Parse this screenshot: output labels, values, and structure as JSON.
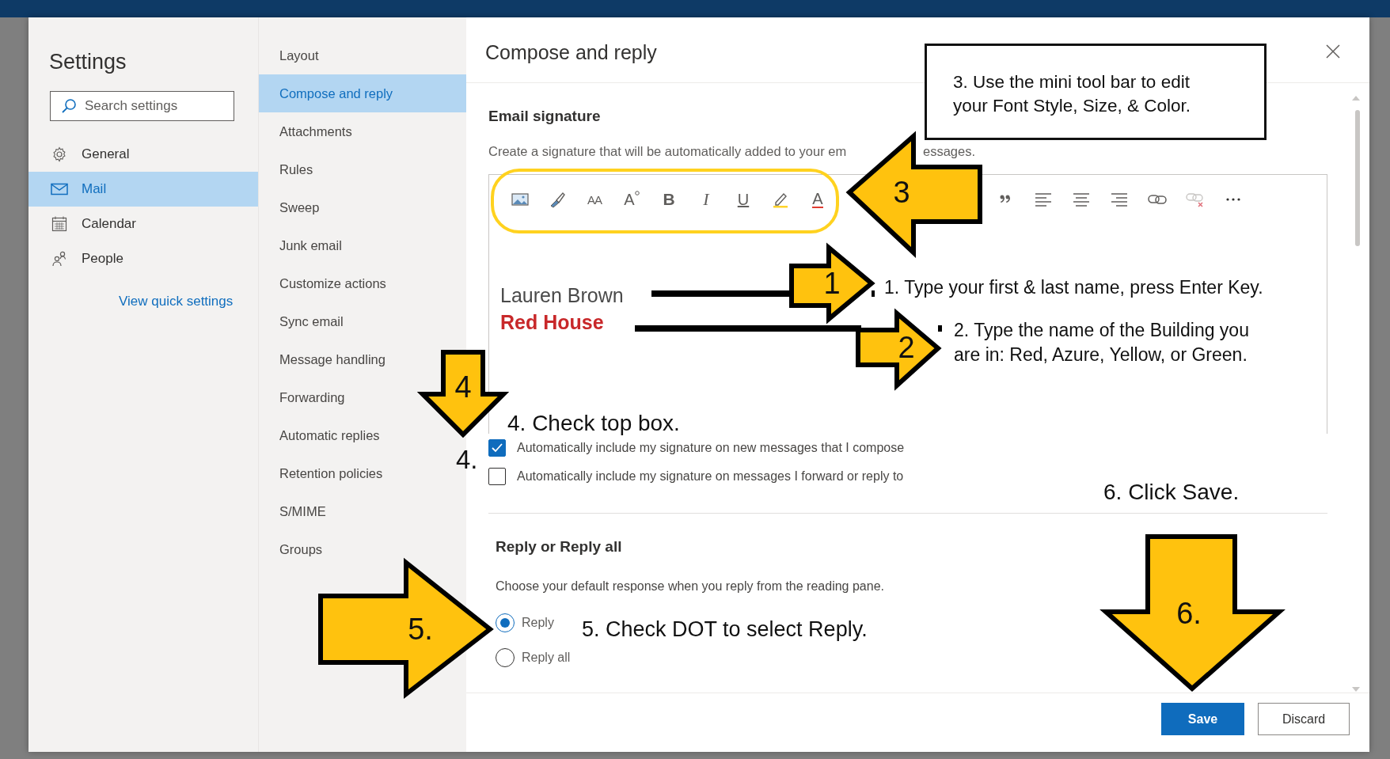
{
  "nav": {
    "title": "Settings",
    "search": {
      "placeholder": "Search settings"
    },
    "items": [
      {
        "label": "General",
        "selected": false
      },
      {
        "label": "Mail",
        "selected": true
      },
      {
        "label": "Calendar",
        "selected": false
      },
      {
        "label": "People",
        "selected": false
      }
    ],
    "link": "View quick settings"
  },
  "subnav": {
    "items": [
      {
        "label": "Layout",
        "selected": false
      },
      {
        "label": "Compose and reply",
        "selected": true
      },
      {
        "label": "Attachments",
        "selected": false
      },
      {
        "label": "Rules",
        "selected": false
      },
      {
        "label": "Sweep",
        "selected": false
      },
      {
        "label": "Junk email",
        "selected": false
      },
      {
        "label": "Customize actions",
        "selected": false
      },
      {
        "label": "Sync email",
        "selected": false
      },
      {
        "label": "Message handling",
        "selected": false
      },
      {
        "label": "Forwarding",
        "selected": false
      },
      {
        "label": "Automatic replies",
        "selected": false
      },
      {
        "label": "Retention policies",
        "selected": false
      },
      {
        "label": "S/MIME",
        "selected": false
      },
      {
        "label": "Groups",
        "selected": false
      }
    ]
  },
  "pane": {
    "title": "Compose and reply",
    "signature": {
      "heading": "Email signature",
      "description": "Create a signature that will be automatically added to your em",
      "description_tail": "essages.",
      "toolbar_left": [
        {
          "kind": "picture"
        },
        {
          "kind": "brush"
        },
        {
          "kind": "font",
          "label": "AA"
        },
        {
          "kind": "grow",
          "label": "A"
        },
        {
          "kind": "bold",
          "label": "B"
        },
        {
          "kind": "italic",
          "label": "I"
        },
        {
          "kind": "underline",
          "label": "U"
        },
        {
          "kind": "highlight"
        },
        {
          "kind": "color",
          "label": "A"
        }
      ],
      "toolbar_right": [
        {
          "kind": "quote"
        },
        {
          "kind": "align_left"
        },
        {
          "kind": "align_center"
        },
        {
          "kind": "align_right"
        },
        {
          "kind": "link"
        },
        {
          "kind": "unlink"
        },
        {
          "kind": "more"
        }
      ],
      "lines": [
        {
          "kind": "name",
          "text": "Lauren Brown"
        },
        {
          "kind": "building",
          "text": "Red House"
        }
      ]
    },
    "options": [
      {
        "label": "Automatically include my signature on new messages that I compose",
        "checked": true
      },
      {
        "label": "Automatically include my signature on messages I forward or reply to",
        "checked": false
      }
    ],
    "reply": {
      "heading": "Reply or Reply all",
      "description": "Choose your default response when you reply from the reading pane.",
      "choices": [
        {
          "label": "Reply",
          "selected": true
        },
        {
          "label": "Reply all",
          "selected": false
        }
      ]
    },
    "buttons": [
      {
        "kind": "primary",
        "label": "Save"
      },
      {
        "kind": "secondary",
        "label": "Discard"
      }
    ]
  },
  "annotations": {
    "box": [
      "3. Use the mini tool bar to edit",
      "your Font Style, Size, & Color."
    ],
    "arrows": [
      {
        "label": "3"
      },
      {
        "label": "1"
      },
      {
        "label": "2"
      },
      {
        "label": "4"
      },
      {
        "label": "5."
      },
      {
        "label": "6."
      }
    ],
    "notes": [
      [
        "1. Type your first & last name, press Enter Key."
      ],
      [
        "2. Type the name of the Building you",
        "are in: Red, Azure, Yellow, or Green."
      ],
      [
        "4. Check top box."
      ],
      [
        "5. Check DOT to select Reply."
      ],
      [
        "6. Click Save."
      ]
    ],
    "step_mark": "4."
  }
}
